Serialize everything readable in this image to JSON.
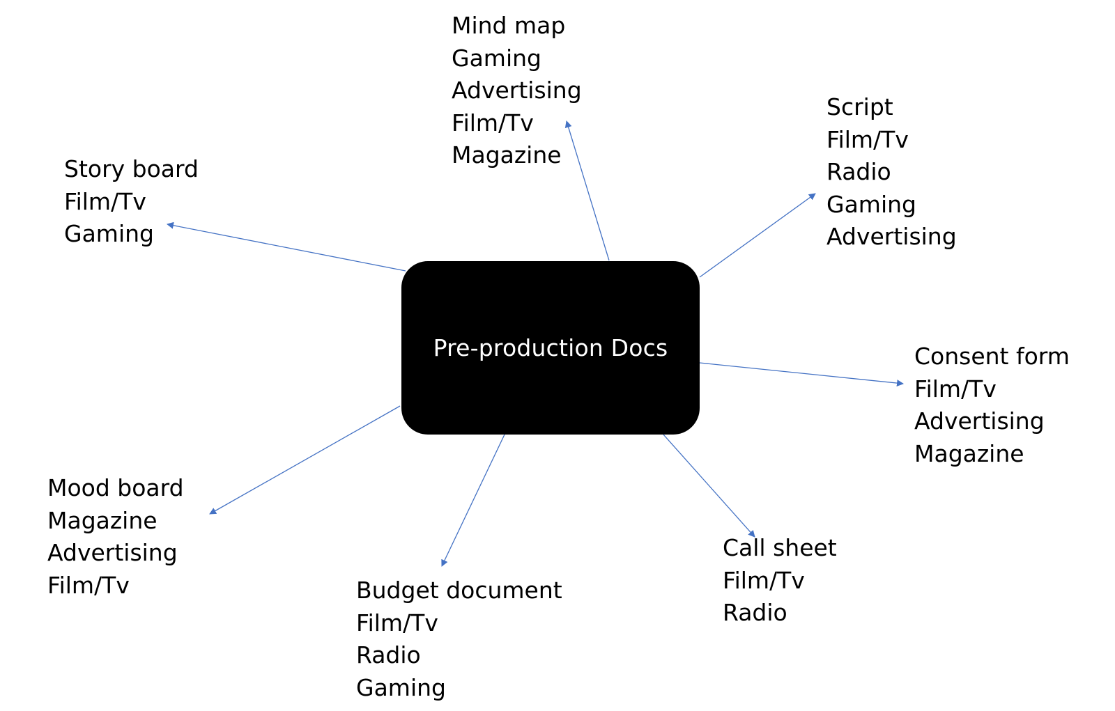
{
  "center": {
    "label": "Pre-production Docs"
  },
  "colors": {
    "arrow": "#4472C4",
    "box": "#000000",
    "box_text": "#ffffff"
  },
  "nodes": {
    "mind_map": {
      "lines": [
        "Mind map",
        "Gaming",
        "Advertising",
        "Film/Tv",
        "Magazine"
      ]
    },
    "script": {
      "lines": [
        "Script",
        "Film/Tv",
        "Radio",
        "Gaming",
        "Advertising"
      ]
    },
    "story_board": {
      "lines": [
        "Story board",
        "Film/Tv",
        "Gaming"
      ]
    },
    "consent_form": {
      "lines": [
        "Consent form",
        "Film/Tv",
        "Advertising",
        "Magazine"
      ]
    },
    "mood_board": {
      "lines": [
        "Mood board",
        "Magazine",
        "Advertising",
        "Film/Tv"
      ]
    },
    "call_sheet": {
      "lines": [
        "Call sheet",
        "Film/Tv",
        "Radio"
      ]
    },
    "budget": {
      "lines": [
        "Budget document",
        "Film/Tv",
        "Radio",
        "Gaming"
      ]
    }
  }
}
